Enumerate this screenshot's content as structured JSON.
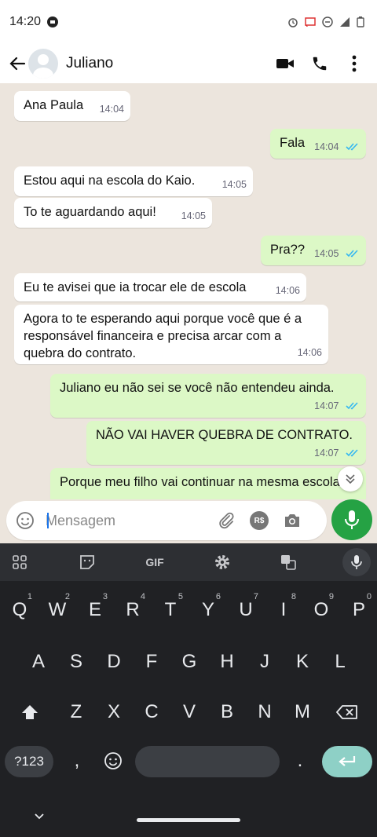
{
  "status_bar": {
    "time": "14:20"
  },
  "header": {
    "contact_name": "Juliano"
  },
  "messages": [
    {
      "dir": "in",
      "text": "Ana Paula",
      "time": "14:04"
    },
    {
      "dir": "out",
      "text": "Fala",
      "time": "14:04"
    },
    {
      "dir": "in",
      "text": "Estou aqui na escola do Kaio.",
      "time": "14:05"
    },
    {
      "dir": "in",
      "text": "To te aguardando aqui!",
      "time": "14:05"
    },
    {
      "dir": "out",
      "text": "Pra??",
      "time": "14:05"
    },
    {
      "dir": "in",
      "text": "Eu te avisei que ia trocar ele de escola",
      "time": "14:06"
    },
    {
      "dir": "in",
      "text": "Agora to te esperando aqui porque você que é a responsável financeira e precisa arcar com a quebra do contrato.",
      "time": "14:06"
    },
    {
      "dir": "out",
      "text": "Juliano eu não sei se você não entendeu ainda.",
      "time": "14:07"
    },
    {
      "dir": "out",
      "text": "NÃO VAI HAVER QUEBRA DE CONTRATO.",
      "time": "14:07"
    },
    {
      "dir": "out",
      "text": "Porque meu filho vai continuar na mesma escola",
      "time": ""
    }
  ],
  "composer": {
    "placeholder": "Mensagem",
    "value": "",
    "rs_label": "R$"
  },
  "keyboard": {
    "gif_label": "GIF",
    "row1": [
      {
        "k": "Q",
        "n": "1"
      },
      {
        "k": "W",
        "n": "2"
      },
      {
        "k": "E",
        "n": "3"
      },
      {
        "k": "R",
        "n": "4"
      },
      {
        "k": "T",
        "n": "5"
      },
      {
        "k": "Y",
        "n": "6"
      },
      {
        "k": "U",
        "n": "7"
      },
      {
        "k": "I",
        "n": "8"
      },
      {
        "k": "O",
        "n": "9"
      },
      {
        "k": "P",
        "n": "0"
      }
    ],
    "row2": [
      "A",
      "S",
      "D",
      "F",
      "G",
      "H",
      "J",
      "K",
      "L"
    ],
    "row3": [
      "Z",
      "X",
      "C",
      "V",
      "B",
      "N",
      "M"
    ],
    "sym_label": "?123",
    "comma": ",",
    "period": "."
  },
  "colors": {
    "accent_green": "#25a244",
    "out_bubble": "#dcf8c6",
    "read_tick": "#34b7f1",
    "keyboard_bg": "#202124"
  }
}
